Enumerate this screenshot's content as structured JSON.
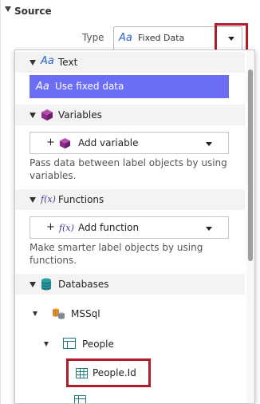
{
  "panel": {
    "section_title": "Source",
    "type_label": "Type",
    "type_value": "Fixed Data",
    "type_icon": "Aa"
  },
  "dropdown": {
    "groups": {
      "text": {
        "label": "Text",
        "icon": "Aa"
      },
      "variables": {
        "label": "Variables",
        "icon": "cube-icon"
      },
      "functions": {
        "label": "Functions",
        "icon": "f(x)"
      },
      "databases": {
        "label": "Databases",
        "icon": "database-icon"
      }
    },
    "text_option": {
      "label": "Use fixed data",
      "icon": "Aa"
    },
    "add_variable": {
      "plus": "+",
      "label": "Add variable"
    },
    "variables_desc": "Pass data between label objects by using variables.",
    "add_function": {
      "plus": "+",
      "label": "Add function"
    },
    "functions_desc": "Make smarter label objects by using functions.",
    "tree": {
      "server": "MSSql",
      "table": "People",
      "field_1": "People.Id"
    }
  },
  "colors": {
    "selection": "#6b6ef5",
    "highlight_border": "#b01c2a",
    "accent_blue": "#2a5fc8",
    "variables_purple": "#8e2c8a",
    "database_teal": "#1f7c80"
  }
}
